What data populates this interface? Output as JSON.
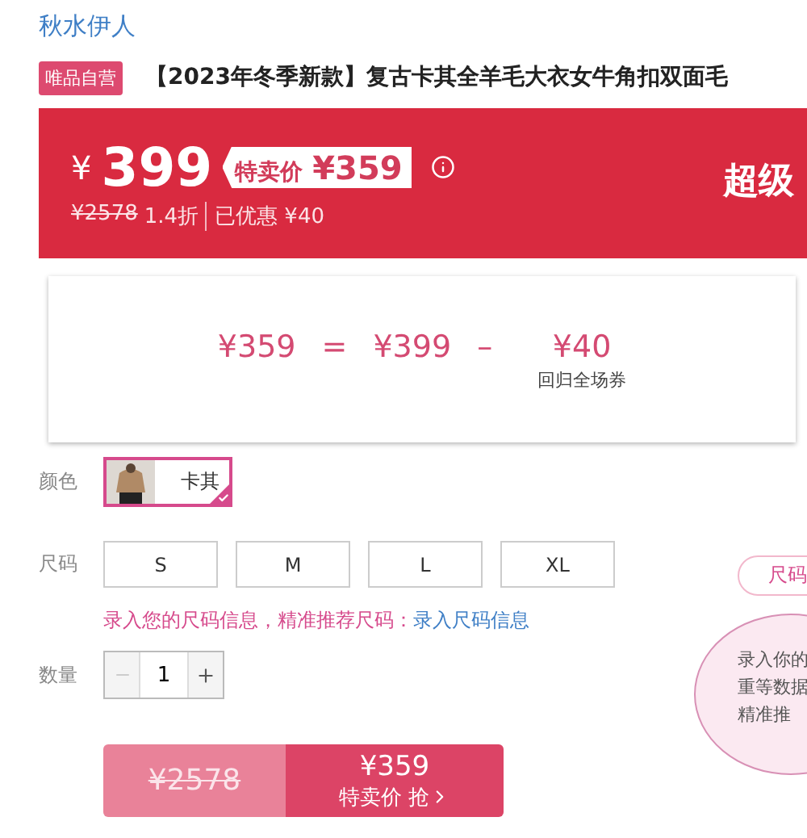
{
  "brand": "秋水伊人",
  "badge": "唯品自营",
  "title": "【2023年冬季新款】复古卡其全羊毛大衣女牛角扣双面毛",
  "price_banner": {
    "currency": "¥",
    "price": "399",
    "special_label": "特卖价",
    "special_price": "¥359",
    "original_price": "¥2578",
    "discount": "1.4折",
    "saved": "已优惠 ¥40",
    "promo": "超级"
  },
  "price_popup": {
    "final": "¥359",
    "equals": "=",
    "base": "¥399",
    "minus": "–",
    "coupon": "¥40",
    "coupon_label": "回归全场券"
  },
  "color": {
    "label": "颜色",
    "options": [
      {
        "name": "卡其",
        "selected": true,
        "kind": "picture"
      }
    ]
  },
  "size": {
    "label": "尺码",
    "options": [
      {
        "label": "S",
        "selected": false
      },
      {
        "label": "M",
        "selected": false
      },
      {
        "label": "L",
        "selected": false
      },
      {
        "label": "XL",
        "selected": false
      }
    ]
  },
  "size_hint": {
    "text": "录入您的尺码信息，精准推荐尺码：",
    "link": "录入尺码信息"
  },
  "quantity": {
    "label": "数量",
    "value": "1",
    "minus_disabled": true
  },
  "buy": {
    "original": "¥2578",
    "price": "¥359",
    "action": "特卖价 抢"
  },
  "size_guide": {
    "tab": "尺码",
    "lines": [
      "录入你的",
      "重等数据",
      "精准推"
    ]
  }
}
